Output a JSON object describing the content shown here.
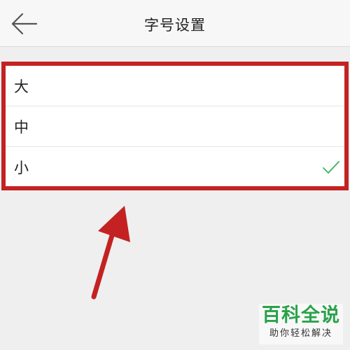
{
  "header": {
    "title": "字号设置",
    "back_icon": "arrow-left-icon"
  },
  "font_size_options": [
    {
      "label": "大",
      "selected": false
    },
    {
      "label": "中",
      "selected": false
    },
    {
      "label": "小",
      "selected": true
    }
  ],
  "selected_icon": "checkmark-icon",
  "colors": {
    "highlight_frame": "#c42222",
    "checkmark": "#3cb35a",
    "watermark_text": "#2aa24a"
  },
  "watermark": {
    "title": "百科全说",
    "subtitle": "助你轻松解决"
  }
}
